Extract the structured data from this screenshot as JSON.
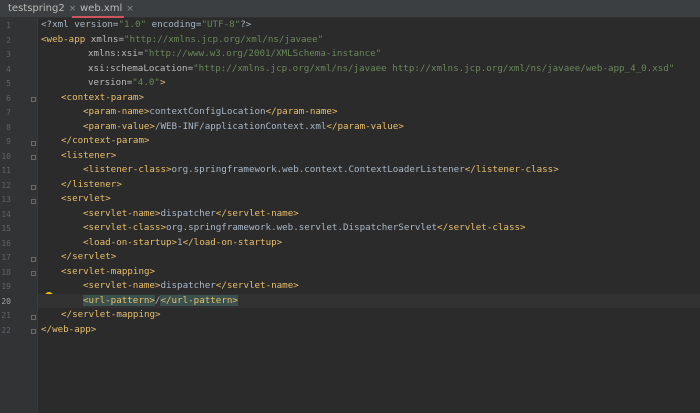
{
  "tabs": [
    {
      "label": "testspring2",
      "close": "×"
    },
    {
      "label": "web.xml",
      "close": "×"
    }
  ],
  "line_numbers": [
    "1",
    "2",
    "3",
    "4",
    "5",
    "6",
    "7",
    "8",
    "9",
    "10",
    "11",
    "12",
    "13",
    "14",
    "15",
    "16",
    "17",
    "18",
    "19",
    "20",
    "21",
    "22"
  ],
  "current_line": "20",
  "code": {
    "l1": {
      "a": "<?xml version=",
      "b": "\"1.0\"",
      "c": " encoding=",
      "d": "\"UTF-8\"",
      "e": "?>"
    },
    "l2": {
      "tag": "<web-app ",
      "attr": "xmlns=",
      "val": "\"http://xmlns.jcp.org/xml/ns/javaee\""
    },
    "l3": {
      "attr": "xmlns:xsi=",
      "val": "\"http://www.w3.org/2001/XMLSchema-instance\""
    },
    "l4": {
      "attr": "xsi:schemaLocation=",
      "val": "\"http://xmlns.jcp.org/xml/ns/javaee http://xmlns.jcp.org/xml/ns/javaee/web-app_4_0.xsd\""
    },
    "l5": {
      "attr": "version=",
      "val": "\"4.0\"",
      "close": ">"
    },
    "l6": {
      "tag": "<context-param>"
    },
    "l7": {
      "open": "<param-name>",
      "text": "contextConfigLocation",
      "close": "</param-name>"
    },
    "l8": {
      "open": "<param-value>",
      "text": "/WEB-INF/applicationContext.xml",
      "close": "</param-value>"
    },
    "l9": {
      "tag": "</context-param>"
    },
    "l10": {
      "tag": "<listener>"
    },
    "l11": {
      "open": "<listener-class>",
      "text": "org.springframework.web.context.ContextLoaderListener",
      "close": "</listener-class>"
    },
    "l12": {
      "tag": "</listener>"
    },
    "l13": {
      "tag": "<servlet>"
    },
    "l14": {
      "open": "<servlet-name>",
      "text": "dispatcher",
      "close": "</servlet-name>"
    },
    "l15": {
      "open": "<servlet-class>",
      "text": "org.springframework.web.servlet.DispatcherServlet",
      "close": "</servlet-class>"
    },
    "l16": {
      "open": "<load-on-startup>",
      "text": "1",
      "close": "</load-on-startup>"
    },
    "l17": {
      "tag": "</servlet>"
    },
    "l18": {
      "tag": "<servlet-mapping>"
    },
    "l19": {
      "open": "<servlet-name>",
      "text": "dispatcher",
      "close": "</servlet-name>"
    },
    "l20": {
      "open": "<url-pattern>",
      "text": "/",
      "close": "</url-pattern>"
    },
    "l21": {
      "tag": "</servlet-mapping>"
    },
    "l22": {
      "tag": "</web-app>"
    }
  },
  "colors": {
    "background": "#2b2b2b",
    "tag": "#e8bf6a",
    "attribute": "#bababa",
    "string": "#6a8759",
    "text": "#a9b7c6",
    "tab_underline": "#cc5560"
  },
  "icons": {
    "lightbulb": "intention-bulb-icon",
    "xml_file": "xml-file-icon",
    "project_file": "project-file-icon"
  }
}
